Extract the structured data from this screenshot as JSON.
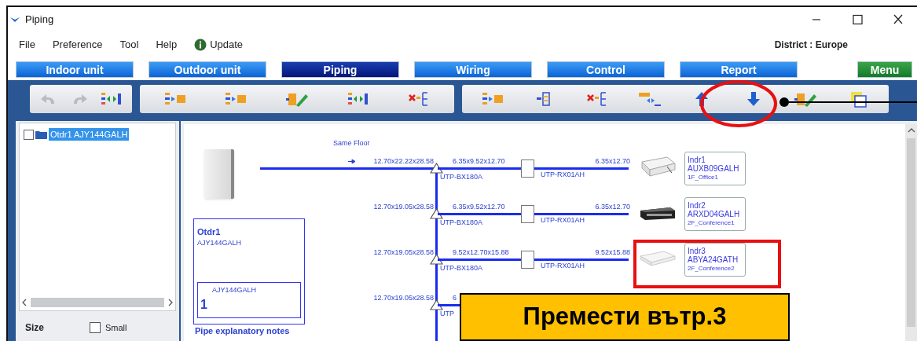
{
  "window": {
    "title": "Piping"
  },
  "menu": [
    {
      "label": "File",
      "kind": "text"
    },
    {
      "label": "Preference",
      "kind": "text"
    },
    {
      "label": "Tool",
      "kind": "text"
    },
    {
      "label": "Help",
      "kind": "text"
    },
    {
      "label": "Update",
      "kind": "info"
    }
  ],
  "district": "District : Europe",
  "tabs": [
    {
      "label": "Indoor unit",
      "selected": false,
      "kind": "main"
    },
    {
      "label": "Outdoor unit",
      "selected": false,
      "kind": "main"
    },
    {
      "label": "Piping",
      "selected": true,
      "kind": "main"
    },
    {
      "label": "Wiring",
      "selected": false,
      "kind": "main"
    },
    {
      "label": "Control",
      "selected": false,
      "kind": "main"
    },
    {
      "label": "Report",
      "selected": false,
      "kind": "main"
    },
    {
      "label": "Menu",
      "selected": false,
      "kind": "menu"
    }
  ],
  "toolbar": [
    [
      {
        "kind": "undo",
        "disabled": true
      },
      {
        "kind": "redo",
        "disabled": true
      },
      {
        "kind": "swap",
        "disabled": false
      }
    ],
    [
      {
        "kind": "list_arrow",
        "disabled": false
      },
      {
        "kind": "list_arrow",
        "disabled": false
      },
      {
        "kind": "edit",
        "disabled": false
      },
      {
        "kind": "swap",
        "disabled": false
      },
      {
        "kind": "delete",
        "disabled": false
      }
    ],
    [
      {
        "kind": "list_arrow",
        "disabled": false
      },
      {
        "kind": "list",
        "disabled": false
      },
      {
        "kind": "delete",
        "disabled": false
      },
      {
        "kind": "connect",
        "disabled": false
      },
      {
        "kind": "up",
        "disabled": false
      },
      {
        "kind": "down",
        "disabled": false
      },
      {
        "kind": "edit",
        "disabled": false
      },
      {
        "kind": "copy",
        "disabled": false
      }
    ]
  ],
  "tree": [
    {
      "label": "Otdr1 AJY144GALH",
      "checked": false,
      "selected": true
    }
  ],
  "size": {
    "label": "Size",
    "option": "Small",
    "checked": false
  },
  "diagram": {
    "floor_label": "Same Floor",
    "outdoor": {
      "name": "Otdr1",
      "model": "AJY144GALH",
      "inner_model": "AJY144GALH",
      "inner_number": "1"
    },
    "branches": [
      {
        "main_pipe": "12.70x22.22x28.58",
        "branch_kit": "UTP-BX180A",
        "branch_pipe": "6.35x9.52x12.70",
        "box_kit": "UTP-RX01AH",
        "end_pipe": "6.35x12.70",
        "unit": {
          "kind": "cassette",
          "name": "Indr1",
          "model": "AUXB09GALH",
          "room": "1F_Office1"
        }
      },
      {
        "main_pipe": "12.70x19.05x28.58",
        "branch_kit": "UTP-BX180A",
        "branch_pipe": "6.35x9.52x12.70",
        "box_kit": "UTP-RX01AH",
        "end_pipe": "6.35x12.70",
        "unit": {
          "kind": "duct",
          "name": "Indr2",
          "model": "ARXD04GALH",
          "room": "2F_Conference1"
        }
      },
      {
        "main_pipe": "12.70x19.05x28.58",
        "branch_kit": "UTP-BX180A",
        "branch_pipe": "9.52x12.70x15.88",
        "box_kit": "UTP-RX01AH",
        "end_pipe": "9.52x15.88",
        "unit": {
          "kind": "cassette_flat",
          "name": "Indr3",
          "model": "ABYA24GATH",
          "room": "2F_Conference2"
        }
      },
      {
        "main_pipe": "12.70x19.05x28.58",
        "branch_kit": "UTP",
        "branch_pipe": "6"
      }
    ],
    "notes": "Pipe explanatory notes"
  },
  "callout": "Премести вътр.3"
}
